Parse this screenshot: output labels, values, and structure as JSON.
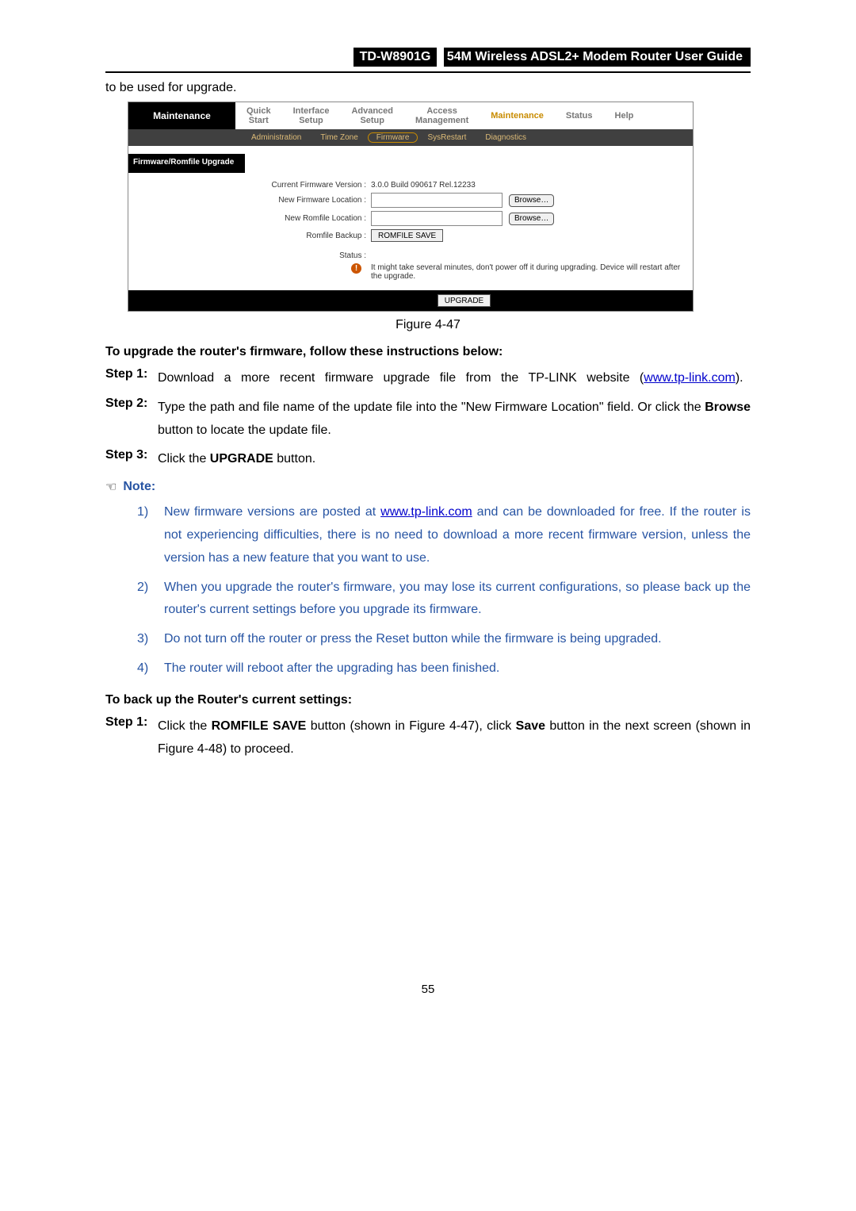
{
  "header": {
    "model": "TD-W8901G",
    "title": "54M Wireless ADSL2+ Modem Router User Guide"
  },
  "intro_text": "to be used for upgrade.",
  "router_ui": {
    "nav_title": "Maintenance",
    "tabs": {
      "quick_start": "Quick\nStart",
      "interface_setup": "Interface\nSetup",
      "advanced_setup": "Advanced\nSetup",
      "access_management": "Access\nManagement",
      "maintenance": "Maintenance",
      "status": "Status",
      "help": "Help"
    },
    "subnav": {
      "administration": "Administration",
      "time_zone": "Time Zone",
      "firmware": "Firmware",
      "sysrestart": "SysRestart",
      "diagnostics": "Diagnostics"
    },
    "section_label": "Firmware/Romfile Upgrade",
    "labels": {
      "current_version": "Current Firmware Version :",
      "new_firmware": "New Firmware Location :",
      "new_romfile": "New Romfile Location :",
      "romfile_backup": "Romfile Backup :",
      "status": "Status :"
    },
    "values": {
      "current_version": "3.0.0 Build 090617 Rel.12233",
      "browse": "Browse…",
      "romfile_save": "ROMFILE SAVE",
      "warning": "It might take several minutes, don't power off it during upgrading. Device will restart after the upgrade.",
      "upgrade": "UPGRADE"
    }
  },
  "figure_caption": "Figure 4-47",
  "upgrade_heading": "To upgrade the router's firmware, follow these instructions below:",
  "steps": {
    "s1_label": "Step 1:",
    "s1_a": "Download a more recent firmware upgrade file from the TP-LINK website (",
    "s1_link": "www.tp-link.com",
    "s1_b": ").",
    "s2_label": "Step 2:",
    "s2_a": "Type the path and file name of the update file into the \"New Firmware Location\" field. Or click the ",
    "s2_bold": "Browse",
    "s2_b": " button to locate the update file.",
    "s3_label": "Step 3:",
    "s3_a": "Click the ",
    "s3_bold": "UPGRADE",
    "s3_b": " button."
  },
  "note_label": "Note:",
  "notes": {
    "n1_a": "New firmware versions are posted at ",
    "n1_link": "www.tp-link.com",
    "n1_b": " and can be downloaded for free. If the router is not experiencing difficulties, there is no need to download a more recent firmware version, unless the version has a new feature that you want to use.",
    "n2": "When you upgrade the router's firmware, you may lose its current configurations, so please back up the router's current settings before you upgrade its firmware.",
    "n3": "Do not turn off the router or press the Reset button while the firmware is being upgraded.",
    "n4": "The router will reboot after the upgrading has been finished."
  },
  "backup_heading": "To back up the Router's current settings:",
  "backup_step": {
    "label": "Step 1:",
    "a": "Click the ",
    "bold1": "ROMFILE SAVE",
    "b": " button (shown in Figure 4-47), click ",
    "bold2": "Save",
    "c": " button in the next screen (shown in Figure 4-48) to proceed."
  },
  "page_number": "55"
}
